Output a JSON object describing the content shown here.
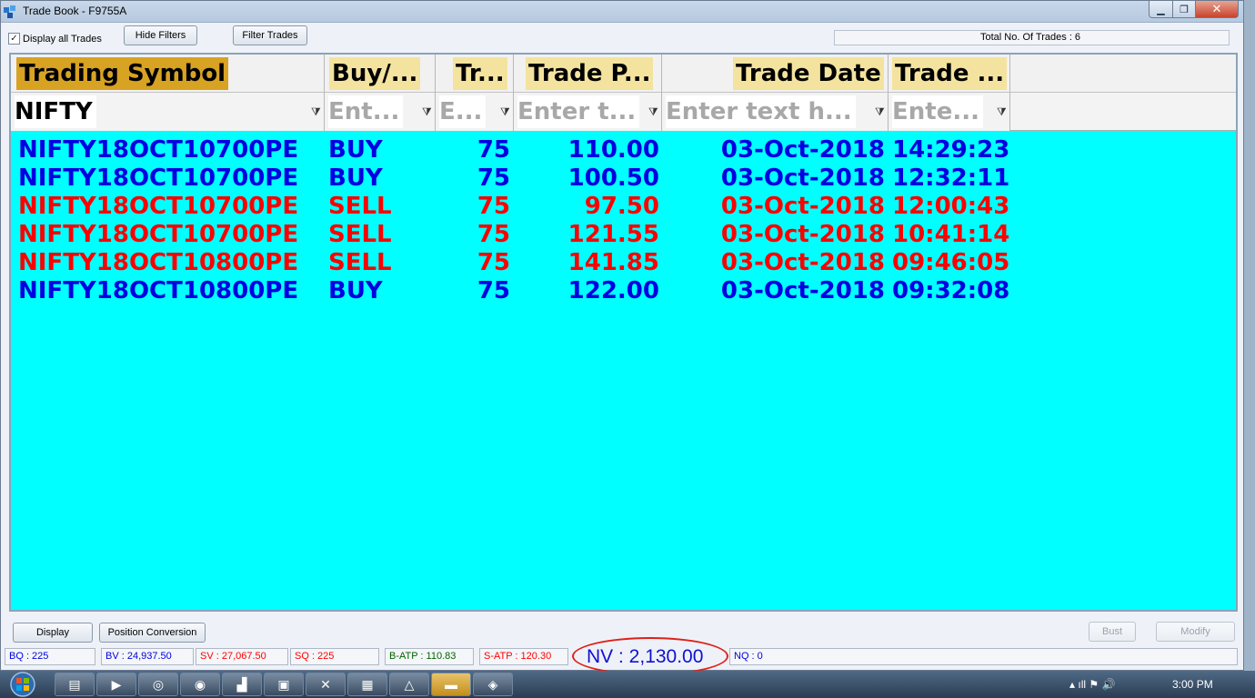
{
  "window": {
    "title": "Trade Book - F9755A",
    "min_glyph": "▁",
    "max_glyph": "❐",
    "close_glyph": "✕"
  },
  "toolbar": {
    "display_all_label": "Display all Trades",
    "display_all_checked": "✓",
    "hide_filters_label": "Hide Filters",
    "filter_trades_label": "Filter Trades",
    "total_trades_text": "Total No. Of Trades : 6"
  },
  "grid": {
    "columns": [
      "Trading Symbol",
      "Buy/...",
      "Tr...",
      "Trade P...",
      "Trade Date",
      "Trade ..."
    ],
    "filters": [
      "NIFTY",
      "Ent...",
      "E...",
      "Enter t...",
      "Enter text h...",
      "Ente..."
    ],
    "funnel_glyph": "⧩",
    "rows": [
      {
        "symbol": "NIFTY18OCT10700PE",
        "side": "BUY",
        "qty": "75",
        "price": "110.00",
        "date": "03-Oct-2018",
        "time": "14:29:23",
        "color": "#0000e0"
      },
      {
        "symbol": "NIFTY18OCT10700PE",
        "side": "BUY",
        "qty": "75",
        "price": "100.50",
        "date": "03-Oct-2018",
        "time": "12:32:11",
        "color": "#0000e0"
      },
      {
        "symbol": "NIFTY18OCT10700PE",
        "side": "SELL",
        "qty": "75",
        "price": "97.50",
        "date": "03-Oct-2018",
        "time": "12:00:43",
        "color": "#ff0000"
      },
      {
        "symbol": "NIFTY18OCT10700PE",
        "side": "SELL",
        "qty": "75",
        "price": "121.55",
        "date": "03-Oct-2018",
        "time": "10:41:14",
        "color": "#ff0000"
      },
      {
        "symbol": "NIFTY18OCT10800PE",
        "side": "SELL",
        "qty": "75",
        "price": "141.85",
        "date": "03-Oct-2018",
        "time": "09:46:05",
        "color": "#ff0000"
      },
      {
        "symbol": "NIFTY18OCT10800PE",
        "side": "BUY",
        "qty": "75",
        "price": "122.00",
        "date": "03-Oct-2018",
        "time": "09:32:08",
        "color": "#0000e0"
      }
    ]
  },
  "actions": {
    "display_label": "Display",
    "position_conversion_label": "Position Conversion",
    "bust_label": "Bust",
    "modify_label": "Modify"
  },
  "status": {
    "bq": "BQ : 225",
    "bv": "BV : 24,937.50",
    "sv": "SV : 27,067.50",
    "sq": "SQ : 225",
    "batp": "B-ATP : 110.83",
    "satp": "S-ATP : 120.30",
    "nv": "NV : 2,130.00",
    "nq": "NQ : 0",
    "buy_color": "#0000e0",
    "sell_color": "#ff0000"
  },
  "taskbar": {
    "clock": "3:00 PM",
    "tray_icons": "▴ ıll ⚑ 🔊"
  }
}
